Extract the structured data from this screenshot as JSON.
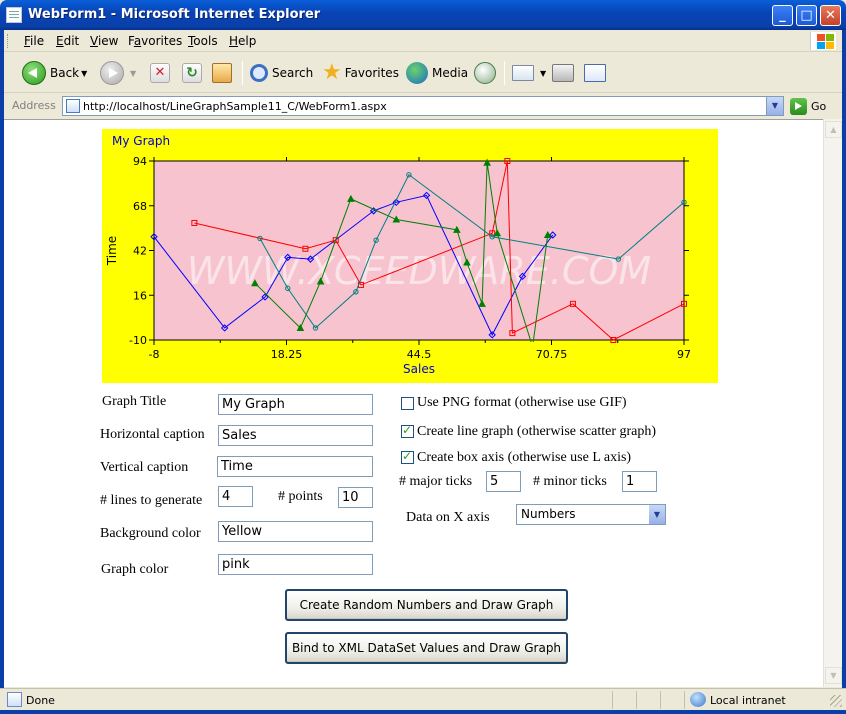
{
  "window": {
    "title": "WebForm1 - Microsoft Internet Explorer",
    "controls": [
      "_",
      "□",
      "✕"
    ]
  },
  "menubar": {
    "items": [
      {
        "label": "File",
        "u": "F",
        "rest": "ile"
      },
      {
        "label": "Edit",
        "u": "E",
        "rest": "dit"
      },
      {
        "label": "View",
        "u": "V",
        "rest": "iew"
      },
      {
        "label": "Favorites",
        "u": "a",
        "pre": "F",
        "rest": "vorites"
      },
      {
        "label": "Tools",
        "u": "T",
        "rest": "ools"
      },
      {
        "label": "Help",
        "u": "H",
        "rest": "elp"
      }
    ]
  },
  "toolbar": {
    "back": "Back",
    "search": "Search",
    "favorites": "Favorites",
    "media": "Media"
  },
  "address": {
    "label": "Address",
    "url": "http://localhost/LineGraphSample11_C/WebForm1.aspx",
    "go": "Go"
  },
  "graph": {
    "title": "My Graph",
    "watermark": "WWW.XCEEDWARE.COM",
    "background_color": "#ffff00",
    "plot_color": "#f7c3cf",
    "x_axis_label": "Sales",
    "y_axis_label": "Time",
    "x_ticks": [
      "-8",
      "18.25",
      "44.5",
      "70.75",
      "97"
    ],
    "y_ticks": [
      "94",
      "68",
      "42",
      "16",
      "-10"
    ]
  },
  "chart_data": {
    "type": "line",
    "title": "My Graph",
    "xlabel": "Sales",
    "ylabel": "Time",
    "xlim": [
      -8,
      97
    ],
    "ylim": [
      -10,
      94
    ],
    "grid": false,
    "legend": "none",
    "series": [
      {
        "color": "#0000ff",
        "marker": "diamond",
        "x": [
          -8,
          6,
          14,
          18.5,
          23,
          35.5,
          40,
          46,
          59,
          65,
          71
        ],
        "y": [
          50,
          -3,
          15,
          38,
          37,
          65,
          70,
          74,
          -7,
          27,
          51
        ]
      },
      {
        "color": "#ff0000",
        "marker": "square",
        "x": [
          0,
          22,
          28,
          33,
          59,
          62,
          63,
          75,
          83,
          97
        ],
        "y": [
          58,
          43,
          48,
          22,
          52,
          94,
          -6,
          11,
          -10,
          11
        ]
      },
      {
        "color": "#008000",
        "marker": "triangle",
        "x": [
          12,
          21,
          25,
          31,
          40,
          52,
          54,
          57,
          58,
          60,
          67,
          70
        ],
        "y": [
          23,
          -3,
          24,
          72,
          60,
          54,
          35,
          11,
          93,
          52,
          -14,
          51
        ]
      },
      {
        "color": "#008080",
        "marker": "circle",
        "x": [
          13,
          18.5,
          24,
          32,
          36,
          42.5,
          59,
          84,
          97
        ],
        "y": [
          49,
          20,
          -3,
          18,
          48,
          86,
          50,
          37,
          70
        ]
      }
    ]
  },
  "form": {
    "graph_title_label": "Graph Title",
    "graph_title_value": "My Graph",
    "horizontal_caption_label": "Horizontal caption",
    "horizontal_caption_value": "Sales",
    "vertical_caption_label": "Vertical caption",
    "vertical_caption_value": "Time",
    "lines_label": "# lines to generate",
    "lines_value": "4",
    "points_label": "# points",
    "points_value": "10",
    "background_color_label": "Background color",
    "background_color_value": "Yellow",
    "graph_color_label": "Graph color",
    "graph_color_value": "pink",
    "png_label": "Use PNG format (otherwise use GIF)",
    "png_checked": false,
    "line_graph_label": "Create line graph (otherwise scatter graph)",
    "line_graph_checked": true,
    "box_axis_label": "Create box axis (otherwise use L axis)",
    "box_axis_checked": true,
    "major_ticks_label": "# major ticks",
    "major_ticks_value": "5",
    "minor_ticks_label": "# minor ticks",
    "minor_ticks_value": "1",
    "data_on_x_label": "Data on X axis",
    "data_on_x_value": "Numbers",
    "button_random": "Create Random Numbers and Draw Graph",
    "button_xml": "Bind to XML DataSet Values and Draw Graph"
  },
  "status": {
    "text": "Done",
    "zone": "Local intranet"
  }
}
